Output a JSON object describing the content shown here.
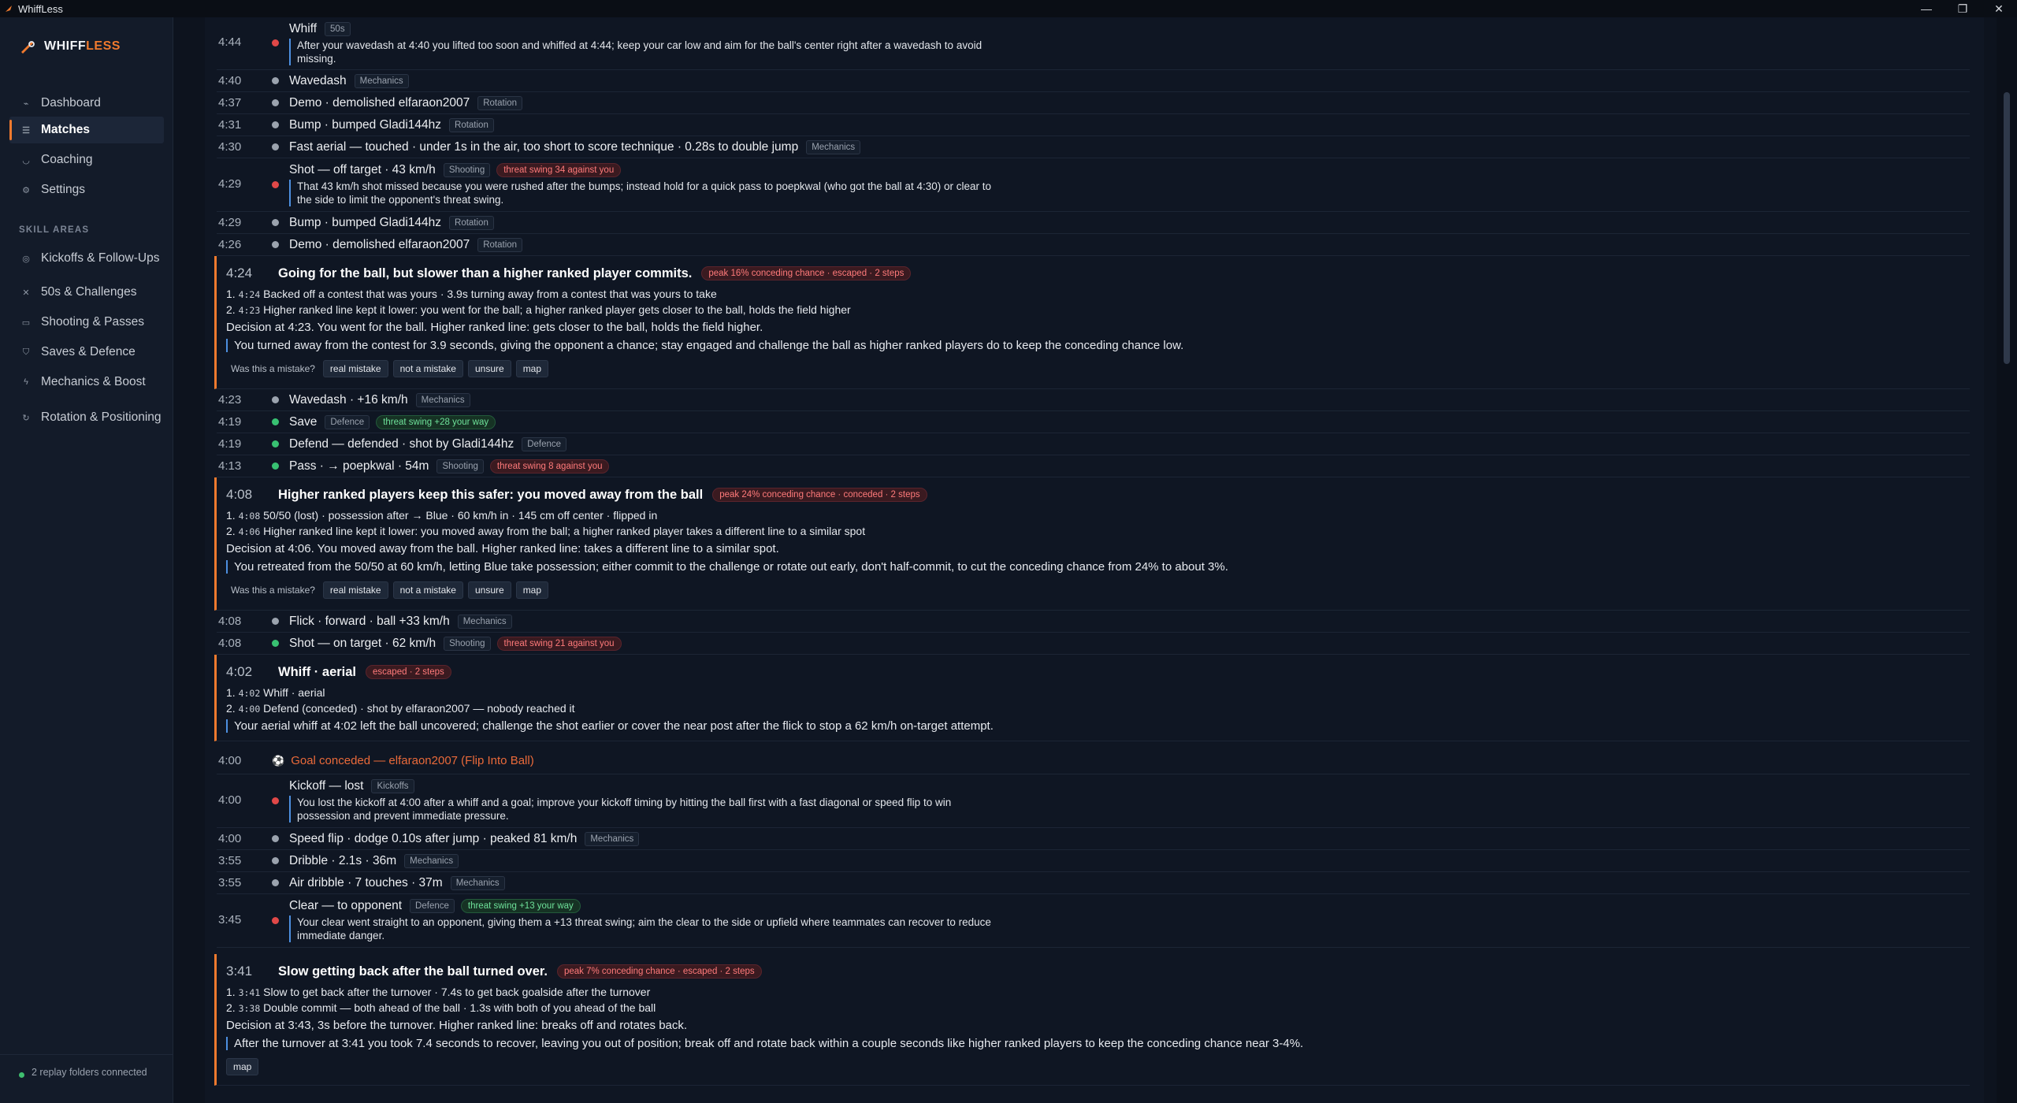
{
  "window": {
    "title": "WhiffLess",
    "controls": [
      "—",
      "❐",
      "✕"
    ]
  },
  "sidebar": {
    "logo": {
      "part1": "WHIFF",
      "part2": "LESS"
    },
    "main_nav": [
      {
        "label": "Dashboard",
        "icon": "chart-line-icon"
      },
      {
        "label": "Matches",
        "icon": "list-icon",
        "active": true
      },
      {
        "label": "Coaching",
        "icon": "headset-icon"
      },
      {
        "label": "Settings",
        "icon": "gear-icon"
      }
    ],
    "section_label": "SKILL AREAS",
    "skill_nav": [
      {
        "label": "Kickoffs & Follow-Ups",
        "icon": "target-icon"
      },
      {
        "label": "50s & Challenges",
        "icon": "crossed-arrows-icon"
      },
      {
        "label": "Shooting & Passes",
        "icon": "goal-icon"
      },
      {
        "label": "Saves & Defence",
        "icon": "shield-icon"
      },
      {
        "label": "Mechanics & Boost",
        "icon": "lightning-icon"
      },
      {
        "label": "Rotation & Positioning",
        "icon": "rotate-icon"
      }
    ],
    "footer": "2 replay folders connected"
  },
  "feed": {
    "e1": {
      "time": "4:44",
      "title": "Whiff",
      "tag": "50s",
      "note": "After your wavedash at 4:40 you lifted too soon and whiffed at 4:44; keep your car low and aim for the ball's center right after a wavedash to avoid missing."
    },
    "e2": {
      "time": "4:40",
      "title": "Wavedash",
      "tag": "Mechanics"
    },
    "e3": {
      "time": "4:37",
      "title": "Demo · demolished elfaraon2007",
      "tag": "Rotation"
    },
    "e4": {
      "time": "4:31",
      "title": "Bump · bumped Gladi144hz",
      "tag": "Rotation"
    },
    "e5": {
      "time": "4:30",
      "title": "Fast aerial — touched · under 1s in the air, too short to score technique · 0.28s to double jump",
      "tag": "Mechanics"
    },
    "e6": {
      "time": "4:29",
      "title": "Shot — off target · 43 km/h",
      "tag": "Shooting",
      "chip": "threat swing 34 against you",
      "note": "That 43 km/h shot missed because you were rushed after the bumps; instead hold for a quick pass to poepkwal (who got the ball at 4:30) or clear to the side to limit the opponent's threat swing."
    },
    "e7": {
      "time": "4:29",
      "title": "Bump · bumped Gladi144hz",
      "tag": "Rotation"
    },
    "e8": {
      "time": "4:26",
      "title": "Demo · demolished elfaraon2007",
      "tag": "Rotation"
    },
    "c1": {
      "time": "4:24",
      "title": "Going for the ball, but slower than a higher ranked player commits.",
      "chip": "peak 16% conceding chance · escaped · 2 steps",
      "steps": [
        {
          "n": "1.",
          "t": "4:24",
          "text": "Backed off a contest that was yours · 3.9s turning away from a contest that was yours to take"
        },
        {
          "n": "2.",
          "t": "4:23",
          "text": "Higher ranked line kept it lower: you went for the ball; a higher ranked player gets closer to the ball, holds the field higher"
        }
      ],
      "decision": "Decision at 4:23. You went for the ball. Higher ranked line: gets closer to the ball, holds the field higher.",
      "advice": "You turned away from the contest for 3.9 seconds, giving the opponent a chance; stay engaged and challenge the ball as higher ranked players do to keep the conceding chance low.",
      "question": "Was this a mistake?",
      "buttons": [
        "real mistake",
        "not a mistake",
        "unsure",
        "map"
      ]
    },
    "e9": {
      "time": "4:23",
      "title": "Wavedash · +16 km/h",
      "tag": "Mechanics"
    },
    "e10": {
      "time": "4:19",
      "title": "Save",
      "tag": "Defence",
      "chip": "threat swing +28 your way"
    },
    "e11": {
      "time": "4:19",
      "title": "Defend — defended · shot by Gladi144hz",
      "tag": "Defence"
    },
    "e12": {
      "time": "4:13",
      "title": "Pass · → poepkwal · 54m",
      "tag": "Shooting",
      "chip": "threat swing 8 against you"
    },
    "c2": {
      "time": "4:08",
      "title": "Higher ranked players keep this safer: you moved away from the ball",
      "chip": "peak 24% conceding chance · conceded · 2 steps",
      "steps": [
        {
          "n": "1.",
          "t": "4:08",
          "text": "50/50 (lost) · possession after → Blue · 60 km/h in · 145 cm off center · flipped in"
        },
        {
          "n": "2.",
          "t": "4:06",
          "text": "Higher ranked line kept it lower: you moved away from the ball; a higher ranked player takes a different line to a similar spot"
        }
      ],
      "decision": "Decision at 4:06. You moved away from the ball. Higher ranked line: takes a different line to a similar spot.",
      "advice": "You retreated from the 50/50 at 60 km/h, letting Blue take possession; either commit to the challenge or rotate out early, don't half-commit, to cut the conceding chance from 24% to about 3%.",
      "question": "Was this a mistake?",
      "buttons": [
        "real mistake",
        "not a mistake",
        "unsure",
        "map"
      ]
    },
    "e13": {
      "time": "4:08",
      "title": "Flick · forward · ball +33 km/h",
      "tag": "Mechanics"
    },
    "e14": {
      "time": "4:08",
      "title": "Shot — on target · 62 km/h",
      "tag": "Shooting",
      "chip": "threat swing 21 against you"
    },
    "c3": {
      "time": "4:02",
      "title": "Whiff · aerial",
      "chip": "escaped · 2 steps",
      "steps": [
        {
          "n": "1.",
          "t": "4:02",
          "text": "Whiff · aerial"
        },
        {
          "n": "2.",
          "t": "4:00",
          "text": "Defend (conceded) · shot by elfaraon2007 — nobody reached it"
        }
      ],
      "advice": "Your aerial whiff at 4:02 left the ball uncovered; challenge the shot earlier or cover the near post after the flick to stop a 62 km/h on-target attempt."
    },
    "goal": {
      "time": "4:00",
      "text": "Goal conceded — elfaraon2007 (Flip Into Ball)"
    },
    "e15": {
      "time": "4:00",
      "title": "Kickoff — lost",
      "tag": "Kickoffs",
      "note": "You lost the kickoff at 4:00 after a whiff and a goal; improve your kickoff timing by hitting the ball first with a fast diagonal or speed flip to win possession and prevent immediate pressure."
    },
    "e16": {
      "time": "4:00",
      "title": "Speed flip · dodge 0.10s after jump · peaked 81 km/h",
      "tag": "Mechanics"
    },
    "e17": {
      "time": "3:55",
      "title": "Dribble · 2.1s · 36m",
      "tag": "Mechanics"
    },
    "e18": {
      "time": "3:55",
      "title": "Air dribble · 7 touches · 37m",
      "tag": "Mechanics"
    },
    "e19": {
      "time": "3:45",
      "title": "Clear — to opponent",
      "tag": "Defence",
      "chip": "threat swing +13 your way",
      "note": "Your clear went straight to an opponent, giving them a +13 threat swing; aim the clear to the side or upfield where teammates can recover to reduce immediate danger."
    },
    "c4": {
      "time": "3:41",
      "title": "Slow getting back after the ball turned over.",
      "chip": "peak 7% conceding chance · escaped · 2 steps",
      "steps": [
        {
          "n": "1.",
          "t": "3:41",
          "text": "Slow to get back after the turnover · 7.4s to get back goalside after the turnover"
        },
        {
          "n": "2.",
          "t": "3:38",
          "text": "Double commit — both ahead of the ball · 1.3s with both of you ahead of the ball"
        }
      ],
      "decision": "Decision at 3:43, 3s before the turnover. Higher ranked line: breaks off and rotates back.",
      "advice": "After the turnover at 3:41 you took 7.4 seconds to recover, leaving you out of position; break off and rotate back within a couple seconds like higher ranked players to keep the conceding chance near 3-4%.",
      "buttons": [
        "map"
      ]
    }
  },
  "colors": {
    "accent": "#f07a2e",
    "bg": "#0f1623",
    "sidebar": "#131b29",
    "red": "#e04848",
    "green": "#38c172",
    "blue": "#4d8fe0"
  }
}
